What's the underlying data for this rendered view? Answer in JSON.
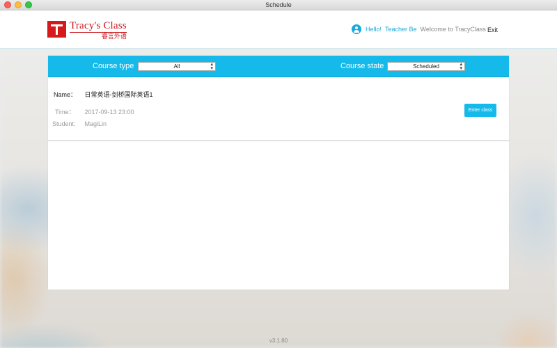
{
  "window": {
    "title": "Schedule"
  },
  "header": {
    "logo_en": "Tracy's Class",
    "logo_cn": "睿言外语",
    "hello": "Hello!",
    "teacher": "Teacher Be",
    "welcome": "Welcome to TracyClass",
    "exit": "Exit"
  },
  "filters": {
    "course_type_label": "Course type",
    "course_type_value": "All",
    "course_state_label": "Course state",
    "course_state_value": "Scheduled"
  },
  "course": {
    "name_label": "Name：",
    "name_value": "日常英语-剑桥国际英语1",
    "time_label": "Time：",
    "time_value": "2017-09-13 23:00",
    "student_label": "Student:",
    "student_value": "MagiLin",
    "enter_label": "Enter class"
  },
  "footer": {
    "version": "v3.1.80"
  },
  "colors": {
    "accent": "#16baea",
    "brand_red": "#d7191c"
  }
}
